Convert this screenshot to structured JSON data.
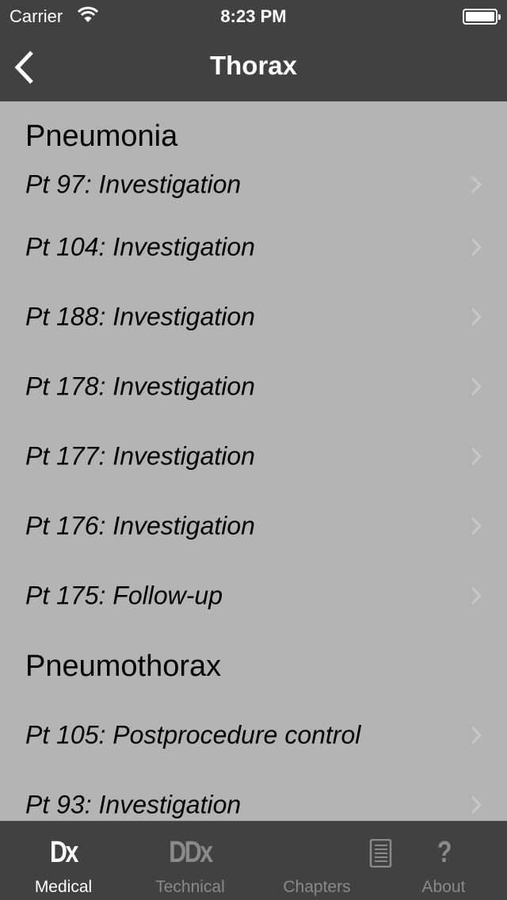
{
  "status_bar": {
    "carrier": "Carrier",
    "time": "8:23 PM",
    "battery_level": 1.0
  },
  "nav": {
    "title": "Thorax",
    "back_icon": "chevron-left-icon"
  },
  "sections": [
    {
      "title": "Pneumonia",
      "rows": [
        "Pt 97: Investigation",
        "Pt 104: Investigation",
        "Pt 188: Investigation",
        "Pt 178: Investigation",
        "Pt 177: Investigation",
        "Pt 176: Investigation",
        "Pt 175: Follow-up"
      ]
    },
    {
      "title": "Pneumothorax",
      "rows": [
        "Pt 105: Postprocedure control",
        "Pt 93: Investigation"
      ]
    }
  ],
  "tabs": [
    {
      "label": "Medical",
      "icon_text": "Dx",
      "active": true
    },
    {
      "label": "Technical",
      "icon_text": "DDx",
      "active": false
    },
    {
      "label": "Chapters",
      "icon": "notebook-icon",
      "active": false
    },
    {
      "label": "About",
      "icon_text": "?",
      "active": false
    }
  ],
  "colors": {
    "bar": "#414141",
    "list_bg": "#b4b4b4",
    "tab_inactive": "#8a8a8a"
  }
}
